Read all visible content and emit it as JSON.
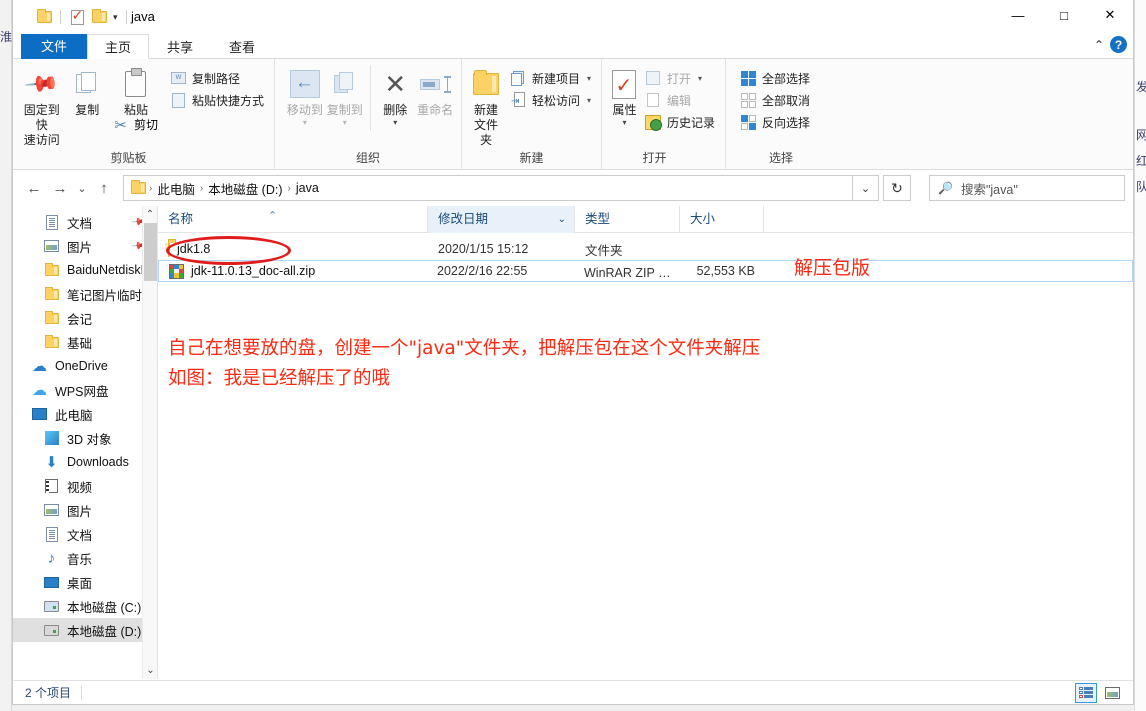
{
  "window": {
    "title": "java",
    "controls": {
      "minimize": "—",
      "maximize": "□",
      "close": "✕"
    }
  },
  "quick_access_toolbar": {
    "folder_label": "folder-icon",
    "properties_label": "properties-icon",
    "new_folder_label": "new-folder-icon",
    "dropdown_caret": "▾"
  },
  "tabs": [
    {
      "label": "文件",
      "type": "file"
    },
    {
      "label": "主页",
      "type": "active"
    },
    {
      "label": "共享",
      "type": "normal"
    },
    {
      "label": "查看",
      "type": "normal"
    }
  ],
  "tabbar_right": {
    "collapse_caret": "⌃",
    "help": "?"
  },
  "ribbon": {
    "groups": [
      {
        "title": "剪贴板",
        "big_buttons": [
          {
            "label": "固定到快\n速访问",
            "icon": "pin-icon",
            "disabled": false
          },
          {
            "label": "复制",
            "icon": "copy-icon",
            "disabled": false
          },
          {
            "label": "粘贴",
            "icon": "paste-icon",
            "disabled": false
          }
        ],
        "small_buttons": [
          {
            "label": "复制路径",
            "icon": "copy-path-icon"
          },
          {
            "label": "粘贴快捷方式",
            "icon": "paste-shortcut-icon"
          }
        ],
        "extra": {
          "label": "剪切",
          "icon": "scissors-icon"
        }
      },
      {
        "title": "组织",
        "big_buttons": [
          {
            "label": "移动到",
            "icon": "move-to-icon",
            "disabled": true,
            "caret": "▾"
          },
          {
            "label": "复制到",
            "icon": "copy-to-icon",
            "disabled": true,
            "caret": "▾"
          },
          {
            "label": "删除",
            "icon": "delete-icon",
            "disabled": false,
            "caret": "▾"
          },
          {
            "label": "重命名",
            "icon": "rename-icon",
            "disabled": true
          }
        ]
      },
      {
        "title": "新建",
        "big_buttons": [
          {
            "label": "新建\n文件夹",
            "icon": "new-folder-icon",
            "disabled": false
          }
        ],
        "small_buttons": [
          {
            "label": "新建项目",
            "icon": "new-item-icon",
            "caret": "▾"
          },
          {
            "label": "轻松访问",
            "icon": "easy-access-icon",
            "caret": "▾"
          }
        ]
      },
      {
        "title": "打开",
        "big_buttons": [
          {
            "label": "属性",
            "icon": "properties-icon",
            "disabled": false,
            "caret": "▾"
          }
        ],
        "small_buttons": [
          {
            "label": "打开",
            "icon": "open-icon",
            "caret": "▾",
            "disabled": true
          },
          {
            "label": "编辑",
            "icon": "edit-icon",
            "disabled": true
          },
          {
            "label": "历史记录",
            "icon": "history-icon",
            "disabled": false
          }
        ]
      },
      {
        "title": "选择",
        "small_buttons": [
          {
            "label": "全部选择",
            "icon": "select-all-icon"
          },
          {
            "label": "全部取消",
            "icon": "select-none-icon"
          },
          {
            "label": "反向选择",
            "icon": "invert-selection-icon"
          }
        ]
      }
    ]
  },
  "address_bar": {
    "back": "←",
    "forward": "→",
    "recent_caret": "⌄",
    "up": "↑",
    "breadcrumbs": [
      "此电脑",
      "本地磁盘 (D:)",
      "java"
    ],
    "separator": "›",
    "dropdown_caret": "⌄",
    "refresh": "↻",
    "search_placeholder": "搜索\"java\"",
    "search_value": ""
  },
  "nav_pane": {
    "items": [
      {
        "label": "文档",
        "icon": "document-icon",
        "indent": true,
        "pinned": true,
        "selected": false
      },
      {
        "label": "图片",
        "icon": "picture-icon",
        "indent": true,
        "pinned": true,
        "selected": false
      },
      {
        "label": "BaiduNetdiskD",
        "icon": "folder-icon",
        "indent": true,
        "pinned": false,
        "selected": false
      },
      {
        "label": "笔记图片临时纯",
        "icon": "folder-icon",
        "indent": true,
        "pinned": false,
        "selected": false
      },
      {
        "label": "会记",
        "icon": "folder-icon",
        "indent": true,
        "pinned": false,
        "selected": false
      },
      {
        "label": "基础",
        "icon": "folder-icon",
        "indent": true,
        "pinned": false,
        "selected": false
      },
      {
        "label": "OneDrive",
        "icon": "onedrive-icon",
        "indent": false,
        "pinned": false,
        "selected": false
      },
      {
        "label": "WPS网盘",
        "icon": "wps-cloud-icon",
        "indent": false,
        "pinned": false,
        "selected": false
      },
      {
        "label": "此电脑",
        "icon": "this-pc-icon",
        "indent": false,
        "pinned": false,
        "selected": false
      },
      {
        "label": "3D 对象",
        "icon": "3d-objects-icon",
        "indent": true,
        "pinned": false,
        "selected": false
      },
      {
        "label": "Downloads",
        "icon": "downloads-icon",
        "indent": true,
        "pinned": false,
        "selected": false
      },
      {
        "label": "视频",
        "icon": "videos-icon",
        "indent": true,
        "pinned": false,
        "selected": false
      },
      {
        "label": "图片",
        "icon": "picture-icon",
        "indent": true,
        "pinned": false,
        "selected": false
      },
      {
        "label": "文档",
        "icon": "document-icon",
        "indent": true,
        "pinned": false,
        "selected": false
      },
      {
        "label": "音乐",
        "icon": "music-icon",
        "indent": true,
        "pinned": false,
        "selected": false
      },
      {
        "label": "桌面",
        "icon": "desktop-icon",
        "indent": true,
        "pinned": false,
        "selected": false
      },
      {
        "label": "本地磁盘 (C:)",
        "icon": "system-drive-icon",
        "indent": true,
        "pinned": false,
        "selected": false
      },
      {
        "label": "本地磁盘 (D:)",
        "icon": "drive-icon",
        "indent": true,
        "pinned": false,
        "selected": true
      }
    ],
    "scroll_up": "⌃",
    "scroll_down": "⌄"
  },
  "file_list": {
    "columns": [
      {
        "label": "名称",
        "sorted": false,
        "sort_arrow": "⌃"
      },
      {
        "label": "修改日期",
        "sorted": true,
        "caret": "⌄"
      },
      {
        "label": "类型",
        "sorted": false
      },
      {
        "label": "大小",
        "sorted": false
      }
    ],
    "rows": [
      {
        "name": "jdk1.8",
        "modified": "2020/1/15 15:12",
        "type": "文件夹",
        "size": "",
        "icon": "folder-icon",
        "selected": false
      },
      {
        "name": "jdk-11.0.13_doc-all.zip",
        "modified": "2022/2/16 22:55",
        "type": "WinRAR ZIP 压缩...",
        "size": "52,553 KB",
        "icon": "zip-icon",
        "selected": true
      }
    ]
  },
  "annotations": {
    "color": "#fb2a12",
    "ellipse_color": "#e01b1b",
    "label_right": "解压包版",
    "line1": "自己在想要放的盘，创建一个\"java\"文件夹，把解压包在这个文件夹解压",
    "line2": "如图：我是已经解压了的哦"
  },
  "status_bar": {
    "item_count": "2 个项目",
    "view_details": "details-view-icon",
    "view_large": "large-icons-view-icon"
  },
  "background_window": {
    "left_fragment": "淮",
    "right_fragments": [
      "发",
      "网",
      "红",
      "队"
    ]
  }
}
